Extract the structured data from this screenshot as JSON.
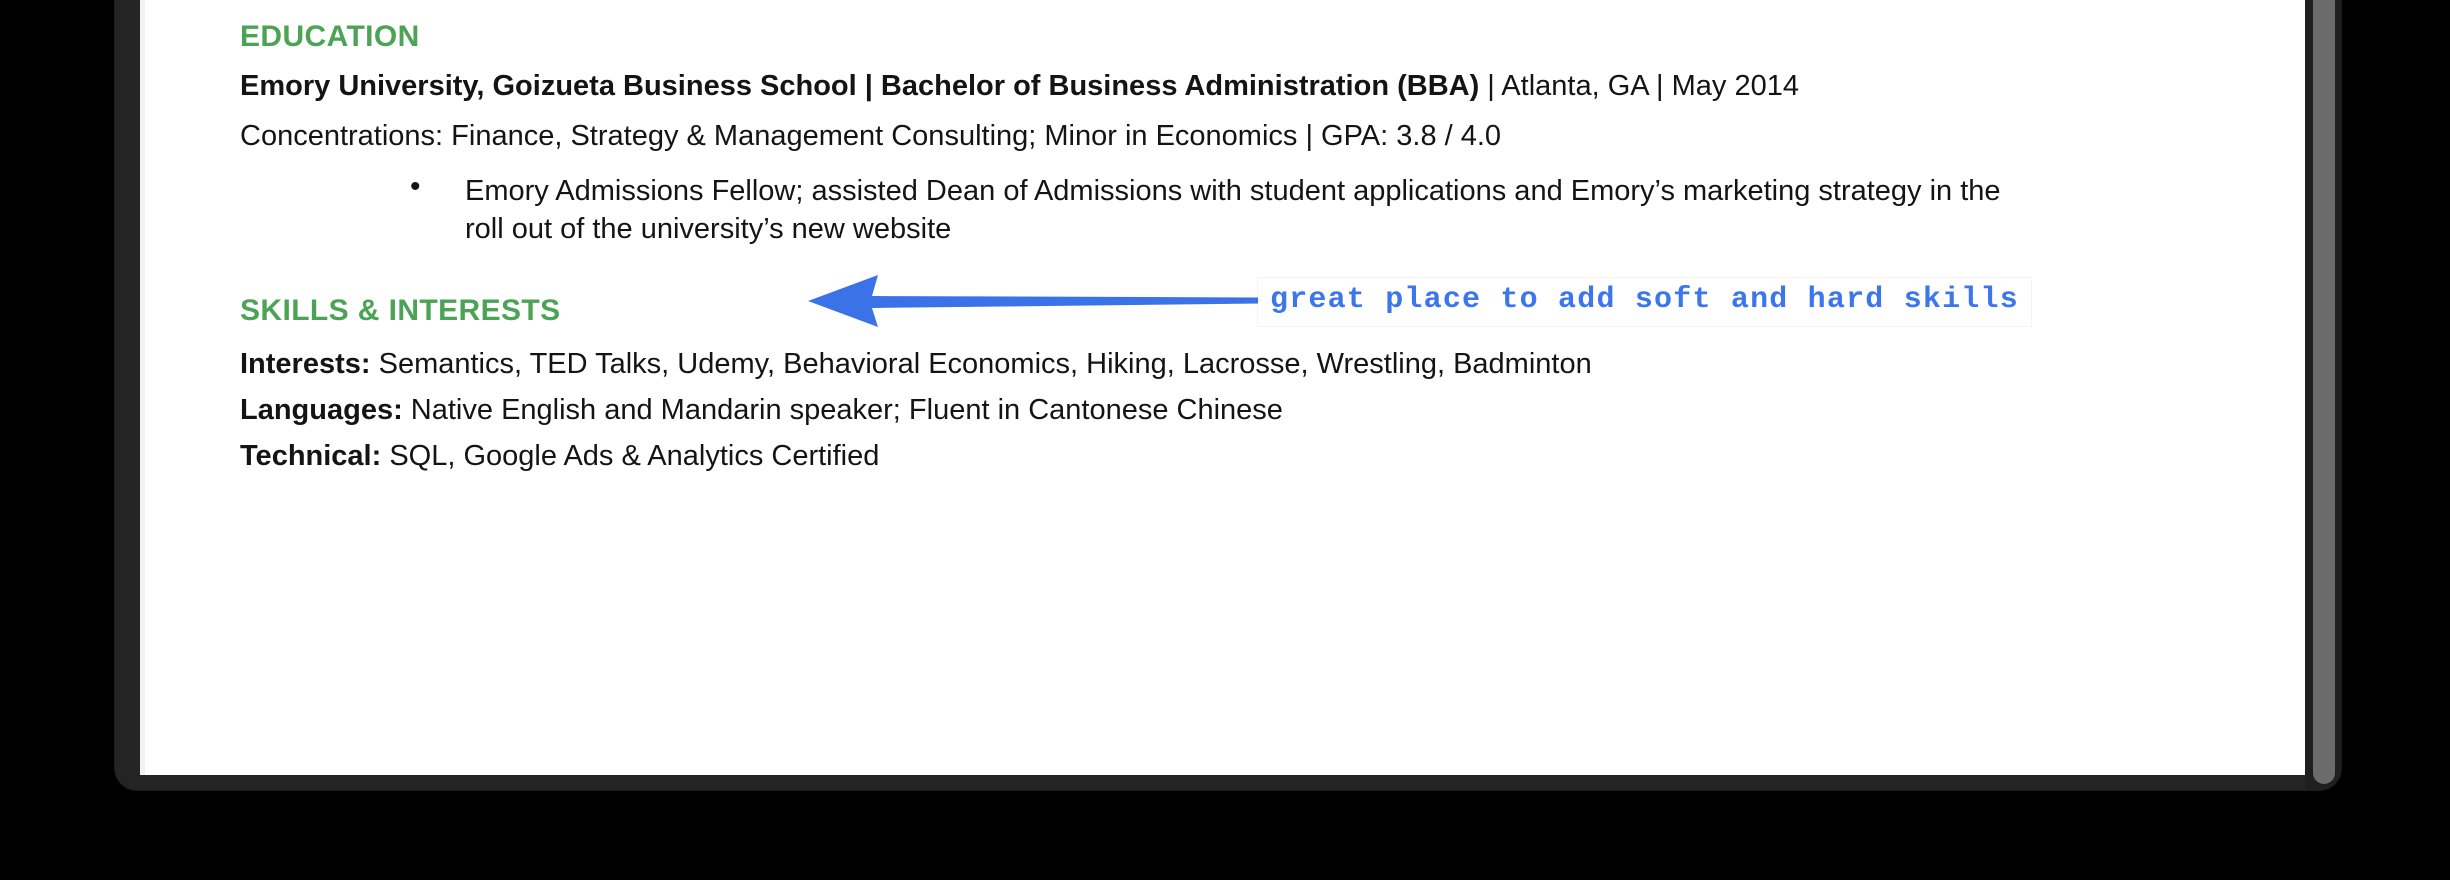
{
  "colors": {
    "section_heading_green": "#4CA356",
    "annotation_blue": "#3B76EC",
    "arrow_blue": "#3B72E8",
    "body_text": "#141414",
    "frame_dark": "#242424",
    "page_white": "#FFFFFF",
    "scrollbar_thumb": "#6B6B6B"
  },
  "document": {
    "education": {
      "heading": "EDUCATION",
      "school_bold": "Emory University, Goizueta Business School | Bachelor of Business Administration (BBA)",
      "school_rest": " | Atlanta, GA | May 2014",
      "concentrations": "Concentrations: Finance, Strategy & Management Consulting; Minor in Economics | GPA: 3.8 / 4.0",
      "bullet_marker": "•",
      "bullet_text": "Emory Admissions Fellow; assisted Dean of Admissions with student applications and Emory’s marketing strategy in the roll out of the university’s new website"
    },
    "skills_interests": {
      "heading": "SKILLS & INTERESTS",
      "rows": [
        {
          "label": "Interests:",
          "value": " Semantics, TED Talks, Udemy, Behavioral Economics, Hiking, Lacrosse, Wrestling, Badminton"
        },
        {
          "label": "Languages:",
          "value": " Native English and Mandarin speaker; Fluent in Cantonese Chinese"
        },
        {
          "label": "Technical:",
          "value": " SQL, Google Ads & Analytics Certified"
        }
      ]
    }
  },
  "annotation": {
    "arrow_direction": "left",
    "callout_text": "great place to add soft and hard skills"
  },
  "scrollbar": {
    "orientation": "vertical",
    "position": "right"
  }
}
